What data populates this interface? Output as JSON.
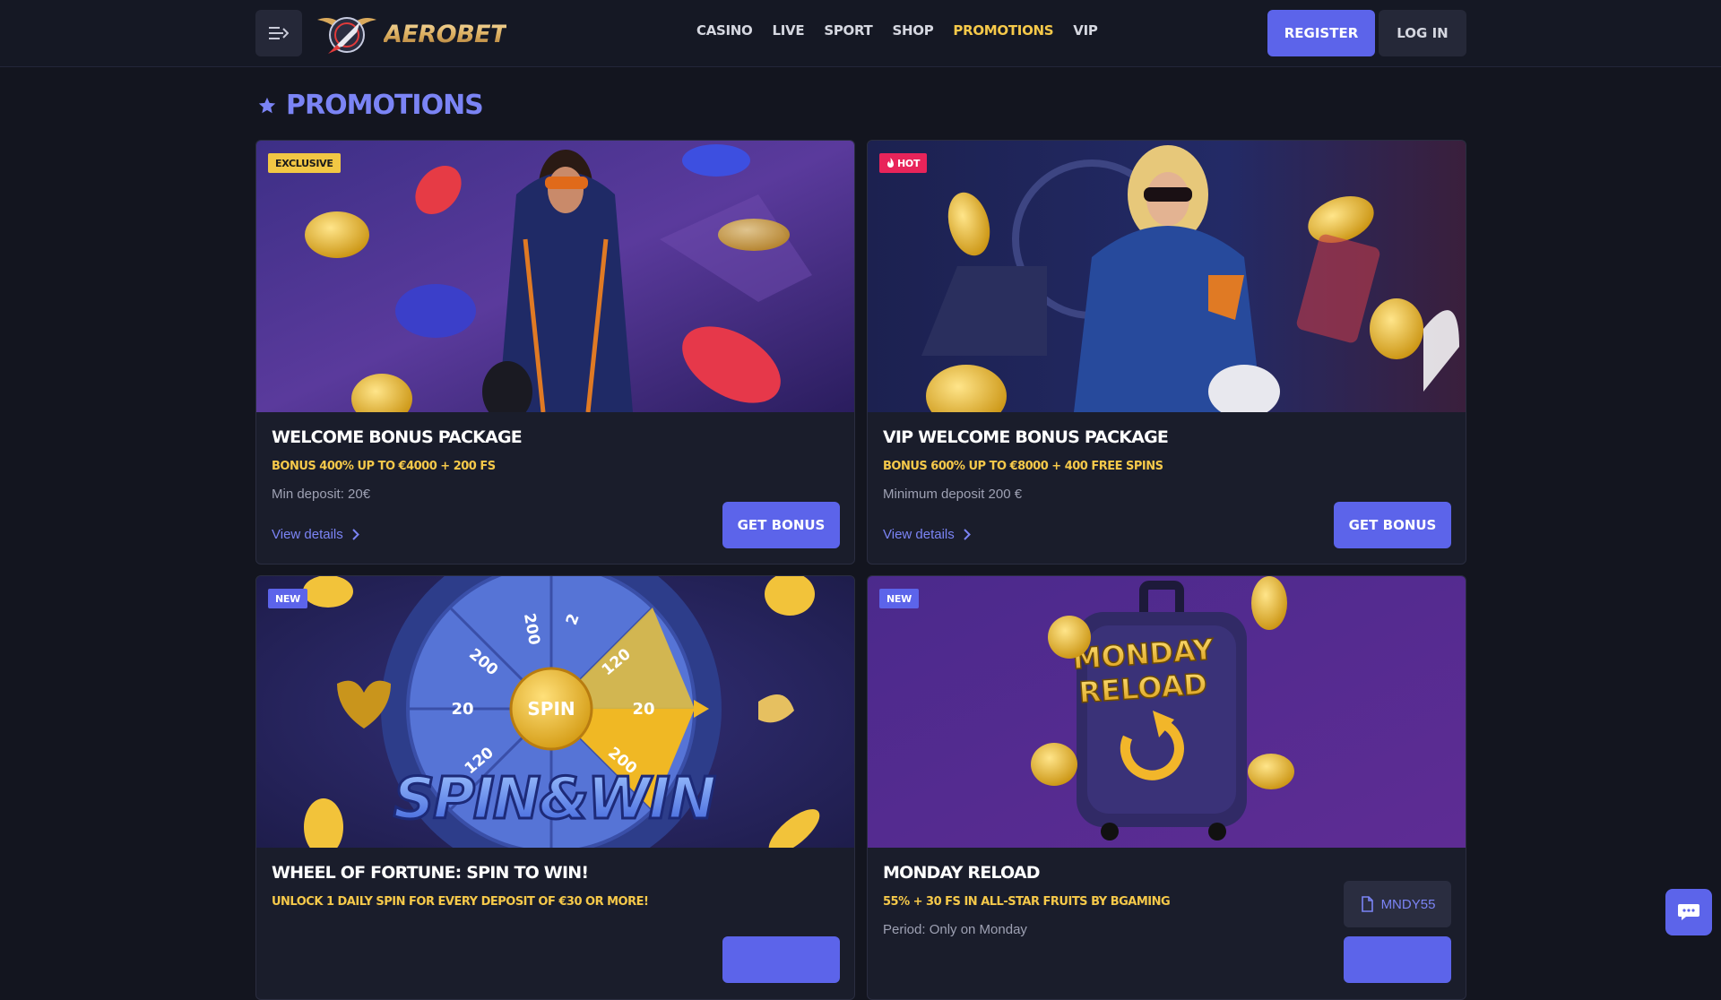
{
  "header": {
    "brand": "AEROBET",
    "nav": [
      {
        "label": "CASINO"
      },
      {
        "label": "LIVE"
      },
      {
        "label": "SPORT"
      },
      {
        "label": "SHOP"
      },
      {
        "label": "PROMOTIONS",
        "active": true
      },
      {
        "label": "VIP"
      }
    ],
    "register_label": "REGISTER",
    "login_label": "LOG IN"
  },
  "page": {
    "title": "PROMOTIONS"
  },
  "cards": [
    {
      "badge": "EXCLUSIVE",
      "title": "WELCOME BONUS PACKAGE",
      "subtitle": "BONUS 400% UP TO €4000 + 200 FS",
      "description": "Min deposit: 20€",
      "link": "View details",
      "button": "GET BONUS"
    },
    {
      "badge": "HOT",
      "title": "VIP WELCOME BONUS PACKAGE",
      "subtitle": "BONUS 600% UP TO €8000 + 400 FREE SPINS",
      "description": "Minimum deposit 200 €",
      "link": "View details",
      "button": "GET BONUS"
    },
    {
      "badge": "NEW",
      "title": "WHEEL OF FORTUNE: SPIN TO WIN!",
      "subtitle": "UNLOCK 1 DAILY SPIN FOR EVERY DEPOSIT OF €30 OR MORE!",
      "image_text": "SPIN&WIN",
      "wheel_center": "SPIN",
      "wheel_values": [
        "200",
        "2",
        "120",
        "20",
        "200",
        "120",
        "20",
        "200"
      ]
    },
    {
      "badge": "NEW",
      "title": "MONDAY RELOAD",
      "subtitle": "55% + 30 FS IN ALL-STAR FRUITS BY BGAMING",
      "description": "Period: Only on Monday",
      "promo_code": "MNDY55",
      "image_text_line1": "MONDAY",
      "image_text_line2": "RELOAD"
    }
  ],
  "colors": {
    "background": "#13151f",
    "card": "#1a1d2b",
    "accent": "#5c64ea",
    "highlight": "#f6c94a",
    "badge_hot": "#e8245a"
  }
}
